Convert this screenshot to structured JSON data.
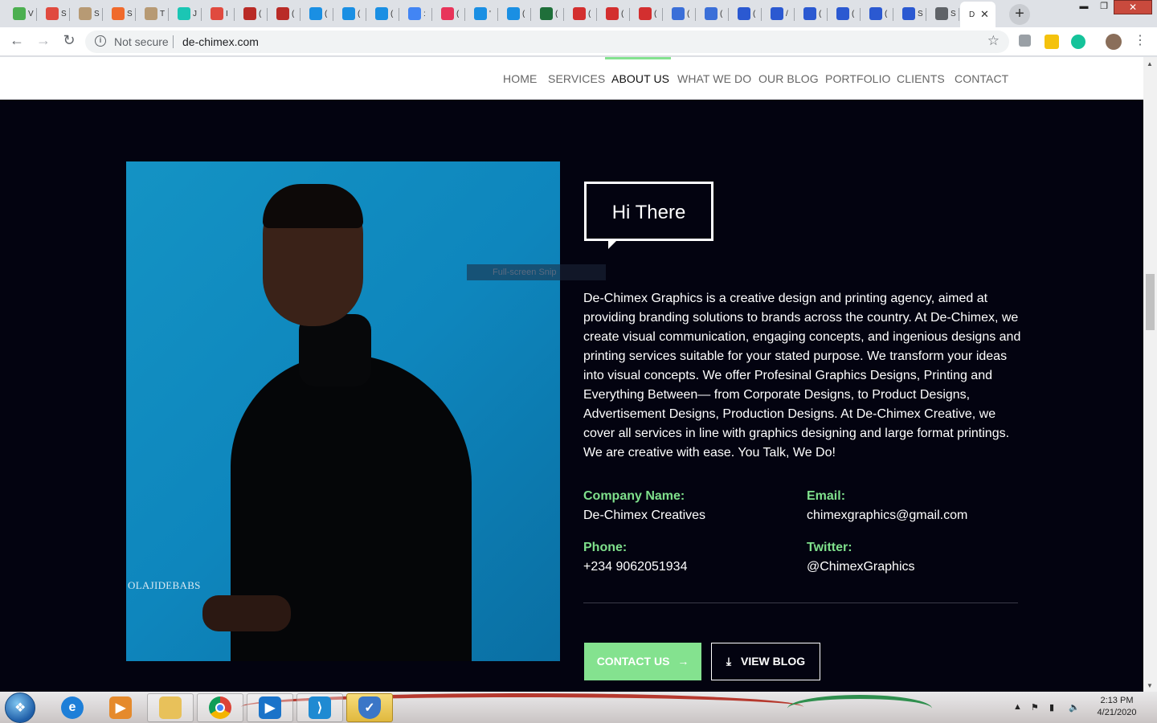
{
  "browser": {
    "active_tab_letter": "D",
    "new_tab_symbol": "+",
    "window_controls": {
      "minimize": "▬",
      "maximize": "❐",
      "close": "✕"
    },
    "nav": {
      "back": "←",
      "forward": "→",
      "reload": "↻"
    },
    "security_label": "Not secure",
    "url": "de-chimex.com",
    "tabs": [
      {
        "icon": "green-circle-icon",
        "letter": "V",
        "color": "#4caf50"
      },
      {
        "icon": "gmail-icon",
        "letter": "S",
        "color": "#e04a3f"
      },
      {
        "icon": "avatar-icon",
        "letter": "S",
        "color": "#b79a74"
      },
      {
        "icon": "bookmark-icon",
        "letter": "S",
        "color": "#f06a2c"
      },
      {
        "icon": "avatar-icon",
        "letter": "T",
        "color": "#b79a74"
      },
      {
        "icon": "y-icon",
        "letter": "J",
        "color": "#1bc6b4"
      },
      {
        "icon": "gmail-icon",
        "letter": "I",
        "color": "#e04a3f"
      },
      {
        "icon": "quora-icon",
        "letter": "(",
        "color": "#b92b27"
      },
      {
        "icon": "quora-icon",
        "letter": "(",
        "color": "#b92b27"
      },
      {
        "icon": "cloud-icon",
        "letter": "(",
        "color": "#1a8fe3"
      },
      {
        "icon": "cloud-icon",
        "letter": "(",
        "color": "#1a8fe3"
      },
      {
        "icon": "cloud-icon",
        "letter": "(",
        "color": "#1a8fe3"
      },
      {
        "icon": "google-icon",
        "letter": ":",
        "color": "#4285f4"
      },
      {
        "icon": "media-icon",
        "letter": "(",
        "color": "#e8345a"
      },
      {
        "icon": "cloud-icon",
        "letter": "'",
        "color": "#1a8fe3"
      },
      {
        "icon": "cloud-icon",
        "letter": "(",
        "color": "#1a8fe3"
      },
      {
        "icon": "drive-icon",
        "letter": "(",
        "color": "#1f6f3a"
      },
      {
        "icon": "oracle-icon",
        "letter": "(",
        "color": "#d32f2f"
      },
      {
        "icon": "oracle-icon",
        "letter": "(",
        "color": "#d32f2f"
      },
      {
        "icon": "oracle-icon",
        "letter": "(",
        "color": "#d32f2f"
      },
      {
        "icon": "link-icon",
        "letter": "(",
        "color": "#3b6fd8"
      },
      {
        "icon": "link-icon",
        "letter": "(",
        "color": "#3b6fd8"
      },
      {
        "icon": "c-icon",
        "letter": "(",
        "color": "#2b59d1"
      },
      {
        "icon": "c-icon",
        "letter": "/",
        "color": "#2b59d1"
      },
      {
        "icon": "c-icon",
        "letter": "(",
        "color": "#2b59d1"
      },
      {
        "icon": "c-icon",
        "letter": "(",
        "color": "#2b59d1"
      },
      {
        "icon": "c-icon",
        "letter": "(",
        "color": "#2b59d1"
      },
      {
        "icon": "c-icon",
        "letter": "S",
        "color": "#2b59d1"
      },
      {
        "icon": "globe-icon",
        "letter": "S",
        "color": "#5f6368"
      }
    ]
  },
  "site": {
    "nav": [
      "HOME",
      "SERVICES",
      "ABOUT US",
      "WHAT WE DO",
      "OUR BLOG",
      "PORTFOLIO",
      "CLIENTS",
      "CONTACT"
    ],
    "active_nav": "ABOUT US",
    "accent_color": "#84e28f",
    "photo_watermark": "OLAJIDEBABS",
    "snip_overlay": "Full-screen Snip",
    "heading": "Hi There",
    "about_text": "De-Chimex Graphics is a creative design and printing agency, aimed at providing branding solutions to brands across the country. At De-Chimex, we create visual communication, engaging concepts, and ingenious designs and printing services suitable for your stated purpose. We transform your ideas into visual concepts. We offer Profesinal Graphics Designs, Printing and Everything Between— from Corporate Designs, to Product Designs, Advertisement Designs, Production Designs. At De-Chimex Creative, we cover all services in line with graphics designing and large format printings. We are creative with ease. You Talk, We Do!",
    "info": {
      "company_label": "Company Name:",
      "company_value": "De-Chimex Creatives",
      "email_label": "Email:",
      "email_value": "chimexgraphics@gmail.com",
      "phone_label": "Phone:",
      "phone_value": "+234 9062051934",
      "twitter_label": "Twitter:",
      "twitter_value": "@ChimexGraphics"
    },
    "buttons": {
      "contact": "CONTACT US",
      "contact_icon": "→",
      "blog": "VIEW BLOG",
      "blog_icon": "⤓"
    }
  },
  "taskbar": {
    "apps": [
      "explorer-ie-icon",
      "media-player-icon",
      "file-explorer-icon",
      "chrome-icon",
      "media-play-icon",
      "vscode-icon",
      "security-shield-icon"
    ],
    "time": "2:13 PM",
    "date": "4/21/2020"
  }
}
